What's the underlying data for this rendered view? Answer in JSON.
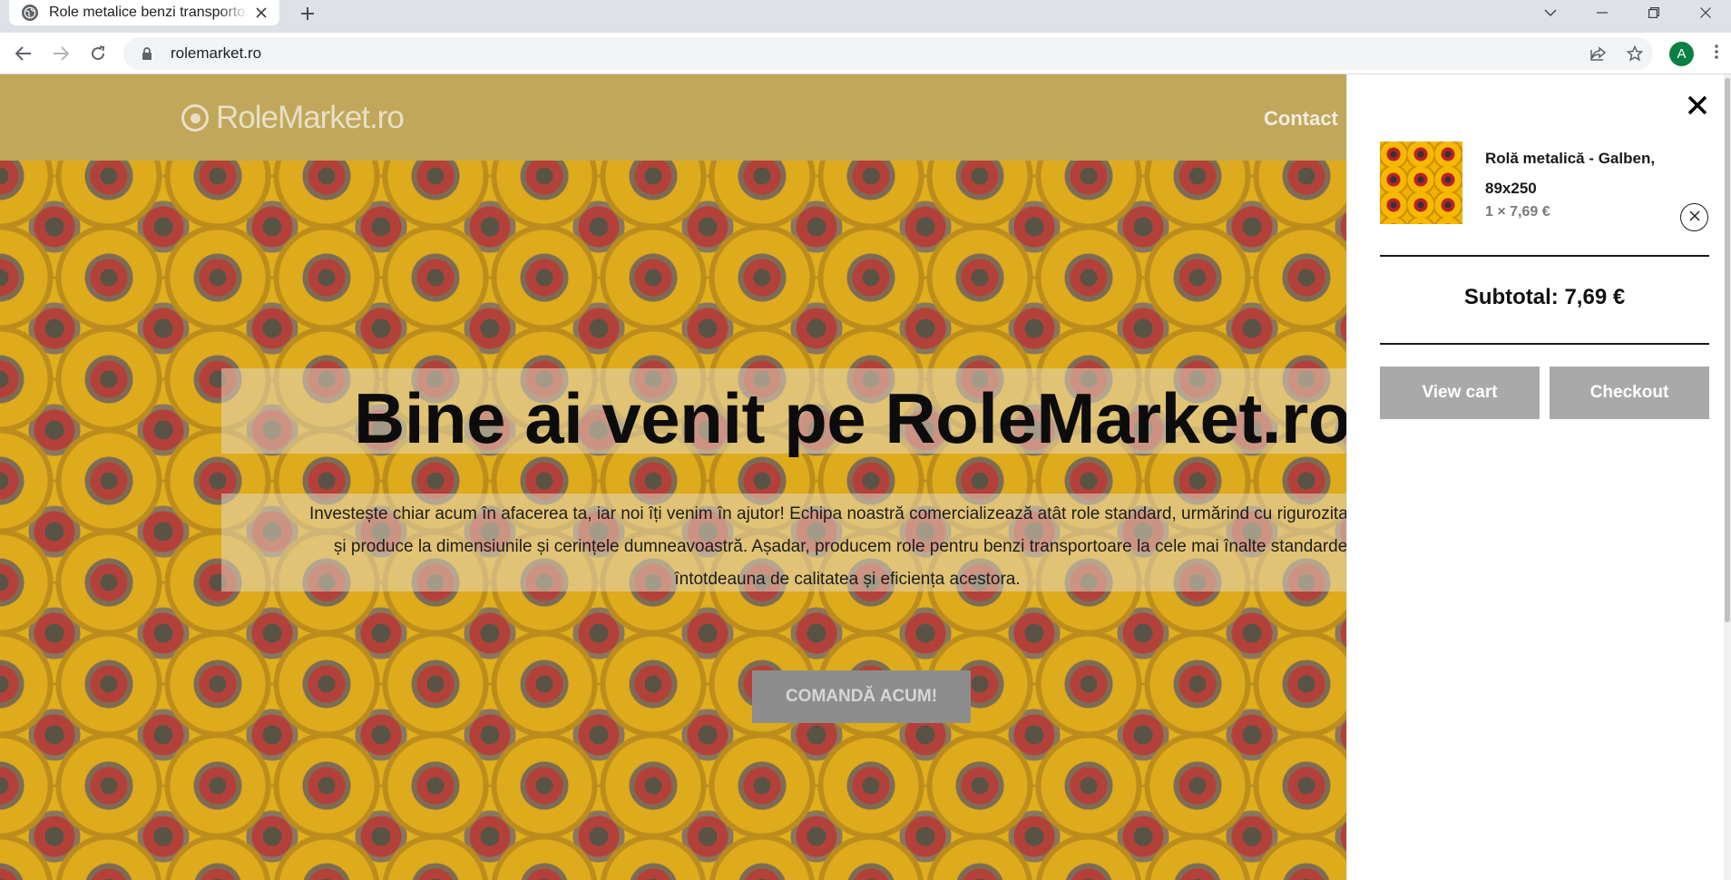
{
  "browser": {
    "tab_title": "Role metalice benzi transportoare",
    "url": "rolemarket.ro",
    "avatar_letter": "A",
    "icons": [
      "globe-icon",
      "close-icon",
      "plus-icon",
      "chevron-down-icon",
      "minimize-icon",
      "restore-icon",
      "window-close-icon",
      "back-icon",
      "forward-icon",
      "reload-icon",
      "lock-icon",
      "share-icon",
      "star-icon",
      "kebab-menu-icon"
    ]
  },
  "site": {
    "logo_text": "RoleMarket.ro",
    "nav_contact": "Contact",
    "welcome_title": "Bine ai venit pe RoleMarket.ro",
    "intro_lines": [
      "Investește chiar acum în afacerea ta, iar noi îți venim în ajutor! Echipa noastră comercializează atât role standard, urmărind cu rigurozitate co",
      "și produce la dimensiunile și cerințele dumneavoastră. Așadar, producem role pentru benzi transportoare la cele mai înalte standarde ș",
      "întotdeauna de calitatea și eficiența acestora."
    ],
    "order_button": "COMANDĂ ACUM!",
    "header_color": "#c0a75a"
  },
  "cart": {
    "item_name": "Rolă metalică - Galben, 89x250",
    "item_qty_price": "1 × 7,69 €",
    "subtotal": "Subtotal: 7,69 €",
    "view_cart": "View cart",
    "checkout": "Checkout",
    "button_color": "#a9a9a9"
  }
}
